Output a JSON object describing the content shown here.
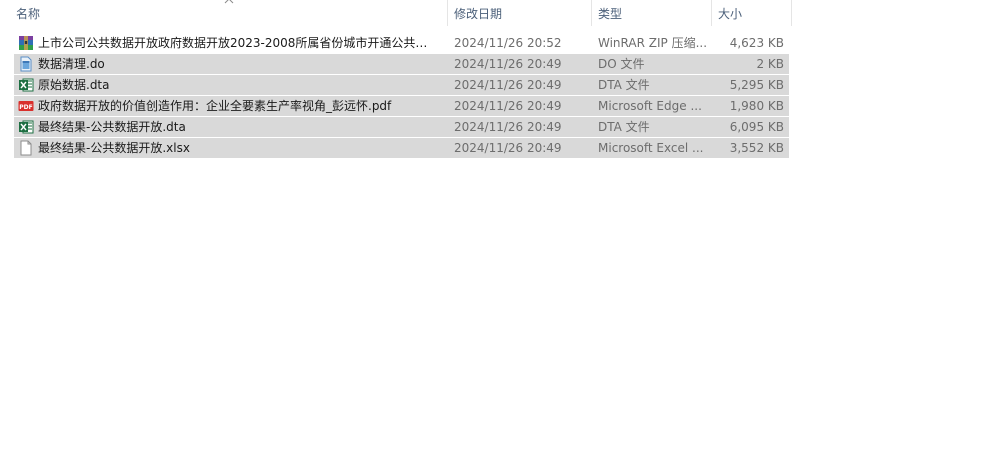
{
  "columns": {
    "name": "名称",
    "date": "修改日期",
    "type": "类型",
    "size": "大小"
  },
  "sort": {
    "column": "name",
    "direction": "ascending",
    "icon": "sort-ascending-icon"
  },
  "files": [
    {
      "name": "上市公司公共数据开放政府数据开放2023-2008所属省份城市开通公共数...",
      "date": "2024/11/26 20:52",
      "type": "WinRAR ZIP 压缩...",
      "size": "4,623 KB",
      "icon": "winrar-archive-icon",
      "selected": false
    },
    {
      "name": "数据清理.do",
      "date": "2024/11/26 20:49",
      "type": "DO 文件",
      "size": "2 KB",
      "icon": "do-file-icon",
      "selected": true
    },
    {
      "name": "原始数据.dta",
      "date": "2024/11/26 20:49",
      "type": "DTA 文件",
      "size": "5,295 KB",
      "icon": "excel-icon",
      "selected": true
    },
    {
      "name": "政府数据开放的价值创造作用：企业全要素生产率视角_彭远怀.pdf",
      "date": "2024/11/26 20:49",
      "type": "Microsoft Edge ...",
      "size": "1,980 KB",
      "icon": "pdf-icon",
      "selected": true
    },
    {
      "name": "最终结果-公共数据开放.dta",
      "date": "2024/11/26 20:49",
      "type": "DTA 文件",
      "size": "6,095 KB",
      "icon": "excel-icon",
      "selected": true
    },
    {
      "name": "最终结果-公共数据开放.xlsx",
      "date": "2024/11/26 20:49",
      "type": "Microsoft Excel ...",
      "size": "3,552 KB",
      "icon": "blank-file-icon",
      "selected": true
    }
  ],
  "colors": {
    "header_text": "#4c607a",
    "selection": "#d9d9d9",
    "excel_green": "#1d6f42",
    "pdf_red": "#d9302c"
  }
}
